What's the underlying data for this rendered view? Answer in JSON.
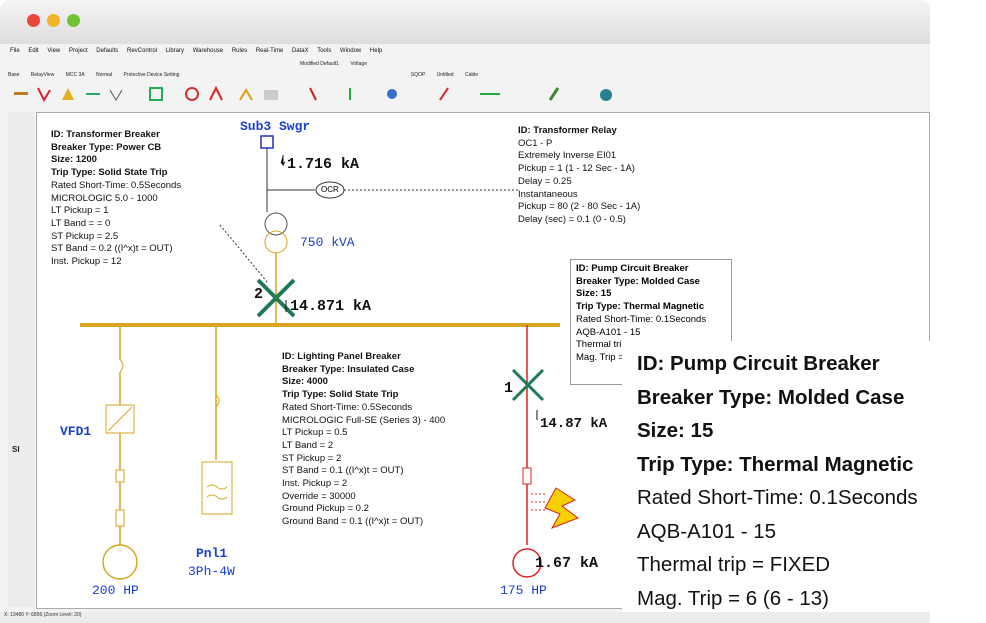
{
  "menu": [
    "File",
    "Edit",
    "View",
    "Project",
    "Defaults",
    "RevControl",
    "Library",
    "Warehouse",
    "Rules",
    "Real-Time",
    "DataX",
    "Tools",
    "Window",
    "Help"
  ],
  "toolbar": {
    "row1": [
      "Modified Default1",
      "Voltage"
    ],
    "row2": [
      "Base",
      "RelayView",
      "MCC 3A",
      "Normal",
      "Protective Device Setting",
      "SQOP",
      "Untitled",
      "Cable"
    ]
  },
  "diagram": {
    "bus_sub3": "Sub3 Swgr",
    "current_top": "1.716 kA",
    "ocr": "OCR",
    "transformer": "750 kVA",
    "breaker2_num": "2",
    "current_bus": "14.871 kA",
    "breaker1_num": "1",
    "current_pump": "14.87 kA",
    "current_motor": "1.67 kA",
    "vfd": "VFD1",
    "pnl": "Pnl1",
    "pnl_sub": "3Ph-4W",
    "hp1": "200 HP",
    "hp2": "175 HP"
  },
  "transformer_breaker": {
    "id": "ID:  Transformer Breaker",
    "type": "Breaker Type:  Power CB",
    "size": "Size:  1200",
    "trip": "Trip Type:  Solid State Trip",
    "lines": [
      "Rated Short-Time:  0.5Seconds",
      "MICROLOGIC 5.0 - 1000",
      "LT Pickup =  1",
      "LT Band =  = 0",
      "ST Pickup =  2.5",
      "ST Band =  0.2 ((I^x)t = OUT)",
      "Inst. Pickup =  12"
    ]
  },
  "transformer_relay": {
    "id": "ID:  Transformer Relay",
    "lines": [
      "OC1 - P",
      "Extremely Inverse EI01",
      "Pickup =  1 (1 - 12  Sec - 1A)",
      "Delay =  0.25",
      "Instantaneous",
      "Pickup =  80 (2 - 80  Sec - 1A)",
      "Delay (sec) =  0.1 (0 - 0.5)"
    ]
  },
  "lighting_breaker": {
    "id": "ID:  Lighting Panel Breaker",
    "type": "Breaker Type:  Insulated Case",
    "size": "Size:  4000",
    "trip": "Trip Type:  Solid State Trip",
    "lines": [
      "Rated Short-Time:  0.5Seconds",
      "MICROLOGIC Full-SE (Series 3) - 400",
      "LT Pickup =  0.5",
      "LT Band =  2",
      "ST Pickup =  2",
      "ST Band =  0.1 ((I^x)t = OUT)",
      "Inst. Pickup =  2",
      "Override =  30000",
      "Ground Pickup =  0.2",
      "Ground Band =  0.1 ((I^x)t =  OUT)"
    ]
  },
  "pump_tooltip": {
    "id": "ID:  Pump Circuit Breaker",
    "type": "Breaker Type:  Molded Case",
    "size": "Size:  15",
    "trip": "Trip Type:  Thermal Magnetic",
    "lines": [
      "Rated Short-Time:  0.1Seconds",
      "AQB-A101 - 15",
      "Thermal trip",
      "Mag. Trip ="
    ]
  },
  "pump_zoom": {
    "id": "ID:  Pump Circuit Breaker",
    "type": "Breaker Type:  Molded Case",
    "size": "Size:  15",
    "trip": "Trip Type:  Thermal Magnetic",
    "lines": [
      "Rated Short-Time:  0.1Seconds",
      "AQB-A101 - 15",
      "Thermal trip =   FIXED",
      "Mag. Trip =   6 (6 - 13)"
    ]
  },
  "status": "X: 13480   Y: 6856 (Zoom Level: 20)",
  "colors": {
    "bus": "#d8a520",
    "green_x": "#1f7a55",
    "red": "#e02020",
    "blue_label": "#1a3fd0"
  }
}
